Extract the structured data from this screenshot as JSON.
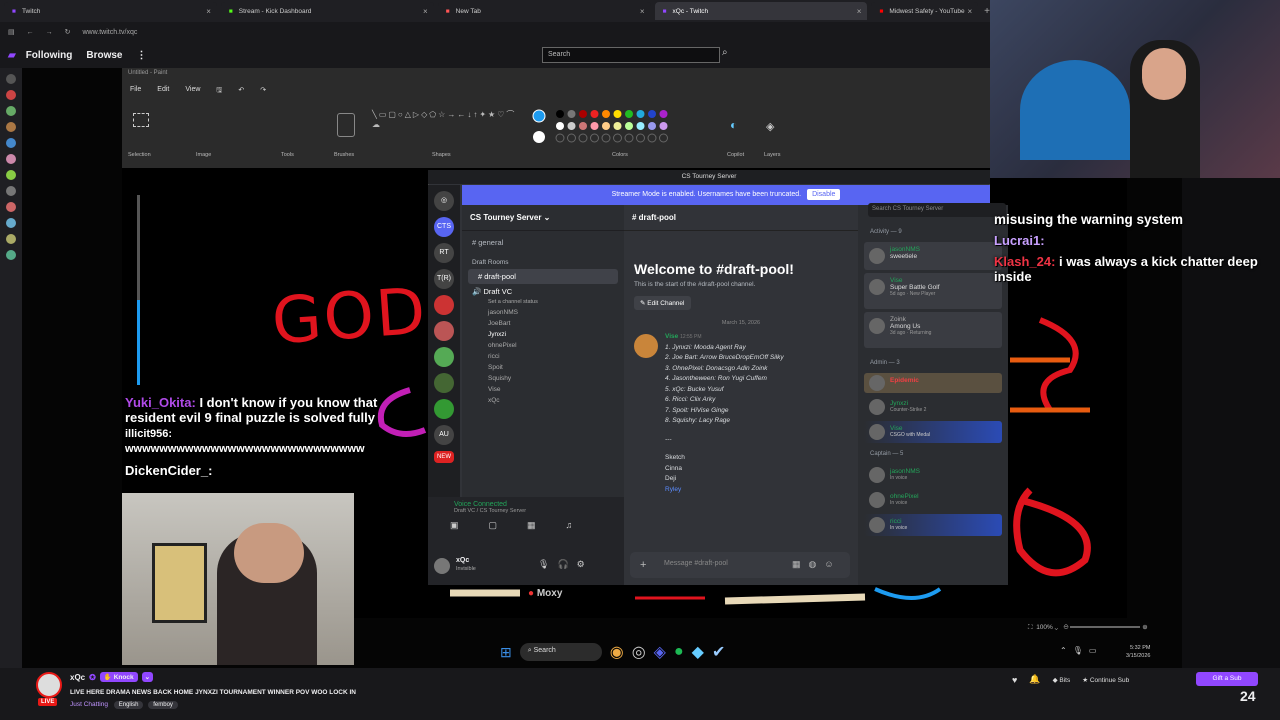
{
  "browser": {
    "tabs": [
      {
        "label": "Twitch",
        "active": false
      },
      {
        "label": "Stream - Kick Dashboard",
        "active": false
      },
      {
        "label": "New Tab",
        "active": false
      },
      {
        "label": "xQc - Twitch",
        "active": true
      },
      {
        "label": "Midwest Safety - YouTube",
        "active": false
      }
    ],
    "url": "www.twitch.tv/xqc"
  },
  "twitch_nav": {
    "following": "Following",
    "browse": "Browse",
    "search_placeholder": "Search"
  },
  "paint": {
    "title": "Untitled - Paint",
    "menu": [
      "File",
      "Edit",
      "View"
    ],
    "ribbon": [
      "Selection",
      "Image",
      "Tools",
      "Brushes",
      "Shapes",
      "Colors",
      "Copilot",
      "Layers"
    ],
    "zoom": "100%",
    "canvas_text": "GOD"
  },
  "discord": {
    "window_title": "CS Tourney Server",
    "streamer_mode": "Streamer Mode is enabled. Usernames have been truncated.",
    "disable": "Disable",
    "server_name": "CS Tourney Server",
    "server_icons": [
      "CTS",
      "RT",
      "T(R)",
      "AU",
      "NEW"
    ],
    "channel_general": "general",
    "category": "Draft Rooms",
    "channel_selected": "draft-pool",
    "voice_channel": "Draft VC",
    "voice_status": "Set a channel status",
    "voice_members": [
      "jasonNMS",
      "JoeBart",
      "Jynxzi",
      "ohnePixel",
      "ricci",
      "Spoit",
      "Squishy",
      "Vise",
      "xQc"
    ],
    "voice_connected": "Voice Connected",
    "voice_sub": "Draft VC / CS Tourney Server",
    "user": "xQc",
    "user_status": "Invisible",
    "chat_channel": "draft-pool",
    "welcome": "Welcome to #draft-pool!",
    "welcome_sub": "This is the start of the #draft-pool channel.",
    "edit_channel": "Edit Channel",
    "date": "March 15, 2026",
    "message_author": "Vise",
    "message_time": "12:55 PM",
    "draft_lines": [
      "1. Jynxzi: Mooda Agent Ray",
      "2. Joe Bart: Arrow BruceDropEmOff Silky",
      "3. OhnePixel: Donacsgo Adin Zoink",
      "4. Jasontheween: Ron Yugi Cuffem",
      "5. xQc: Bucke Yusuf",
      "6. Ricci: Clix Arky",
      "7. Spoit: HiVise Ginge",
      "8. Squishy: Lacy Rage"
    ],
    "separator": "---",
    "extra": [
      "Sketch",
      "Cinna",
      "Deji",
      "Ryley"
    ],
    "input_placeholder": "Message #draft-pool",
    "members_search": "Search CS Tourney Server",
    "activity_header": "Activity — 9",
    "activity": [
      {
        "name": "jasonNMS",
        "detail": "sweetiele",
        "sub": "9 tracks this week"
      },
      {
        "name": "Vise",
        "detail": "Super Battle Golf",
        "sub": "5d ago · New Player"
      },
      {
        "name": "Zoink",
        "detail": "Among Us",
        "sub": "3d ago · Returning"
      }
    ],
    "admin_header": "Admin — 3",
    "admins": [
      {
        "name": "Epidemic",
        "detail": ""
      },
      {
        "name": "Jynxzi",
        "detail": "Counter-Strike 2"
      },
      {
        "name": "Vise",
        "detail": "CSGO with Medal"
      }
    ],
    "captain_header": "Captain — 5",
    "captains": [
      {
        "name": "jasonNMS",
        "detail": "In voice"
      },
      {
        "name": "ohnePixel",
        "detail": "In voice"
      },
      {
        "name": "ricci",
        "detail": "In voice"
      }
    ]
  },
  "overlay_chat_left": [
    {
      "user": "Yuki_Okita:",
      "text": "I don't know if you know that resident evil 9 final puzzle is solved fully"
    },
    {
      "user": "illicit956:",
      "text": "wwwwwwwwwwwwwwwwwwwwwwwwwwww"
    },
    {
      "user": "DickenCider_:",
      "text": ""
    }
  ],
  "overlay_chat_right": [
    {
      "user": "",
      "text": "misusing the warning system"
    },
    {
      "user": "Lucrai1:",
      "text": ""
    },
    {
      "user": "Klash_24:",
      "text": "i was always a kick chatter deep inside"
    }
  ],
  "canvas_label": "Moxy",
  "taskbar": {
    "search": "Search",
    "time": "5:32 PM",
    "date": "3/15/2026"
  },
  "channel": {
    "name": "xQc",
    "badge": "Knock",
    "title": "LIVE HERE DRAMA NEWS BACK HOME JYNXZI TOURNAMENT WINNER POV WOO LOCK IN",
    "category": "Just Chatting",
    "tags": [
      "English",
      "femboy"
    ],
    "live": "LIVE",
    "bits": "Bits",
    "continue_sub": "Continue Sub",
    "gift": "Gift a Sub",
    "viewers": "24"
  }
}
